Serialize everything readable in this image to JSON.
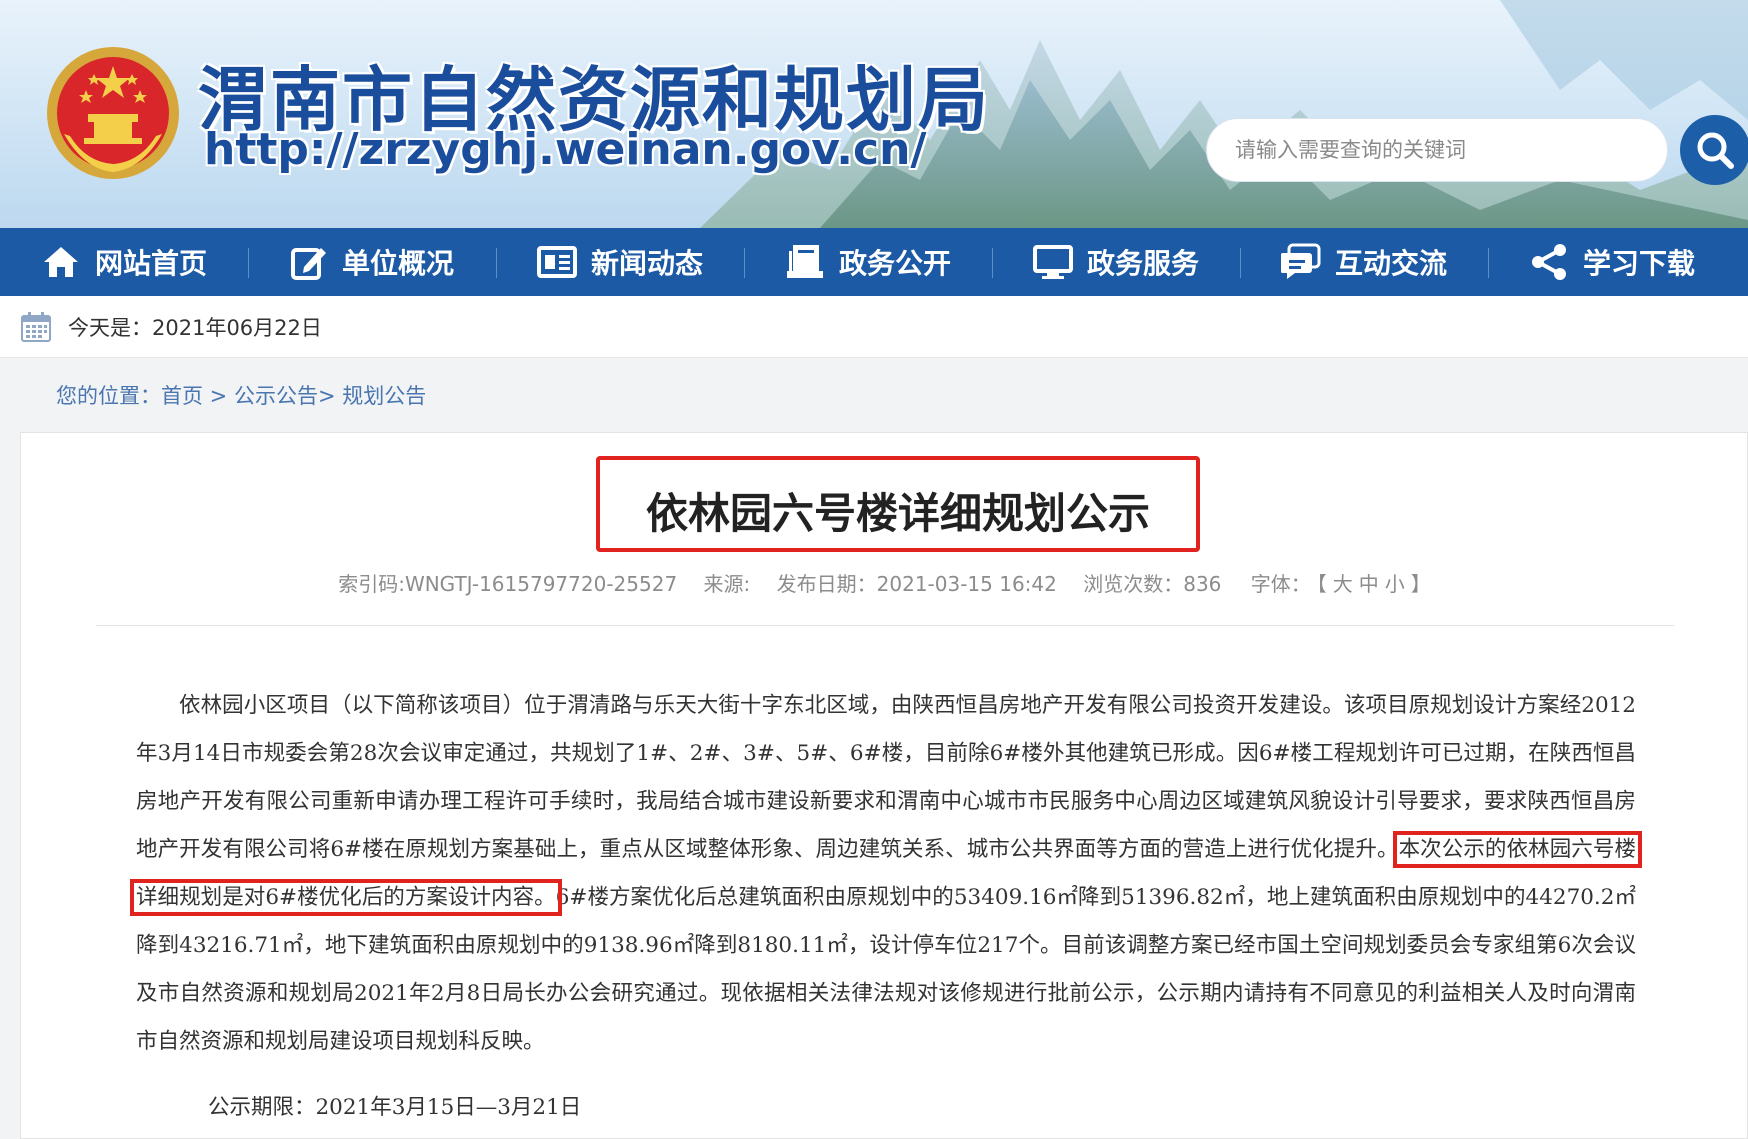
{
  "header": {
    "site_title": "渭南市自然资源和规划局",
    "site_url": "http://zrzyghj.weinan.gov.cn/",
    "search_placeholder": "请输入需要查询的关键词",
    "emblem_icon": "national-emblem-icon",
    "search_icon": "search-icon"
  },
  "nav": {
    "items": [
      {
        "label": "网站首页",
        "icon": "home-icon"
      },
      {
        "label": "单位概况",
        "icon": "edit-icon"
      },
      {
        "label": "新闻动态",
        "icon": "news-icon"
      },
      {
        "label": "政务公开",
        "icon": "book-icon"
      },
      {
        "label": "政务服务",
        "icon": "monitor-icon"
      },
      {
        "label": "互动交流",
        "icon": "chat-icon"
      },
      {
        "label": "学习下载",
        "icon": "share-icon"
      }
    ]
  },
  "datebar": {
    "label": "今天是：2021年06月22日",
    "icon": "calendar-icon"
  },
  "breadcrumb": {
    "prefix": "您的位置：",
    "home": "首页",
    "sep1": " > ",
    "level1": "公示公告",
    "sep2": "> ",
    "level2": "规划公告"
  },
  "article": {
    "title": "依林园六号楼详细规划公示",
    "meta": {
      "index_code": "索引码:WNGTJ-1615797720-25527",
      "source": "来源:",
      "publish_date": "发布日期：2021-03-15 16:42",
      "views": "浏览次数：836",
      "font_label": "字体：",
      "font_open": "【",
      "font_large": "大",
      "font_medium": "中",
      "font_small": "小",
      "font_close": "】"
    },
    "body_part1": "依林园小区项目（以下简称该项目）位于渭清路与乐天大街十字东北区域，由陕西恒昌房地产开发有限公司投资开发建设。该项目原规划设计方案经2012年3月14日市规委会第28次会议审定通过，共规划了1#、2#、3#、5#、6#楼，目前除6#楼外其他建筑已形成。因6#楼工程规划许可已过期，在陕西恒昌房地产开发有限公司重新申请办理工程许可手续时，我局结合城市建设新要求和渭南中心城市市民服务中心周边区域建筑风貌设计引导要求，要求陕西恒昌房地产开发有限公司将6#楼在原规划方案基础上，重点从区域整体形象、周边建筑关系、城市公共界面等方面的营造上进行优化提升。",
    "body_highlight": "本次公示的依林园六号楼详细规划是对6#楼优化后的方案设计内容。",
    "body_part2": "6#楼方案优化后总建筑面积由原规划中的53409.16㎡降到51396.82㎡，地上建筑面积由原规划中的44270.2㎡降到43216.71㎡，地下建筑面积由原规划中的9138.96㎡降到8180.11㎡，设计停车位217个。目前该调整方案已经市国土空间规划委员会专家组第6次会议及市自然资源和规划局2021年2月8日局长办公会研究通过。现依据相关法律法规对该修规进行批前公示，公示期内请持有不同意见的利益相关人及时向渭南市自然资源和规划局建设项目规划科反映。",
    "period": "公示期限：2021年3月15日—3月21日"
  },
  "colors": {
    "nav_bg": "#1c5aa6",
    "title_blue": "#1a4e9c",
    "highlight_red": "#e0231f"
  }
}
